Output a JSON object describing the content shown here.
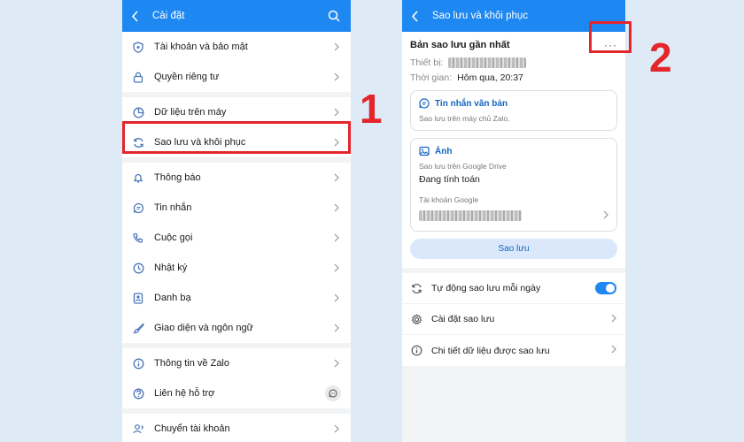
{
  "left": {
    "header": {
      "title": "Cài đặt"
    },
    "groups": [
      [
        {
          "label": "Tài khoản và bảo mật",
          "icon": "shield-icon"
        },
        {
          "label": "Quyền riêng tư",
          "icon": "lock-icon"
        }
      ],
      [
        {
          "label": "Dữ liệu trên máy",
          "icon": "pie-chart-icon"
        },
        {
          "label": "Sao lưu và khôi phục",
          "icon": "sync-icon"
        }
      ],
      [
        {
          "label": "Thông báo",
          "icon": "bell-icon"
        },
        {
          "label": "Tin nhắn",
          "icon": "chat-icon"
        },
        {
          "label": "Cuộc gọi",
          "icon": "phone-icon"
        },
        {
          "label": "Nhật ký",
          "icon": "clock-icon"
        },
        {
          "label": "Danh bạ",
          "icon": "contacts-icon"
        },
        {
          "label": "Giao diện và ngôn ngữ",
          "icon": "brush-icon"
        }
      ],
      [
        {
          "label": "Thông tin về Zalo",
          "icon": "info-icon"
        },
        {
          "label": "Liên hệ hỗ trợ",
          "icon": "help-icon"
        }
      ],
      [
        {
          "label": "Chuyển tài khoản",
          "icon": "switch-user-icon"
        }
      ]
    ]
  },
  "right": {
    "header": {
      "title": "Sao lưu và khôi phục"
    },
    "latest": {
      "title": "Bản sao lưu gần nhất",
      "more": "···",
      "device_label": "Thiết bị:",
      "time_label": "Thời gian:",
      "time_value": "Hôm qua, 20:37"
    },
    "messages_box": {
      "title": "Tin nhắn văn bản",
      "desc": "Sao lưu trên máy chủ Zalo."
    },
    "photos_box": {
      "title": "Ảnh",
      "desc": "Sao lưu trên Google Drive",
      "status": "Đang tính toán",
      "account_label": "Tài khoản Google"
    },
    "backup_button": "Sao lưu",
    "options": [
      {
        "label": "Tự động sao lưu mỗi ngày",
        "type": "toggle",
        "on": true
      },
      {
        "label": "Cài đặt sao lưu",
        "type": "link"
      },
      {
        "label": "Chi tiết dữ liệu được sao lưu",
        "type": "link"
      }
    ]
  },
  "annotations": {
    "step1": "1",
    "step2": "2"
  },
  "colors": {
    "brand": "#1e88f2",
    "highlight": "#e3262b",
    "background": "#dfeaf7"
  }
}
